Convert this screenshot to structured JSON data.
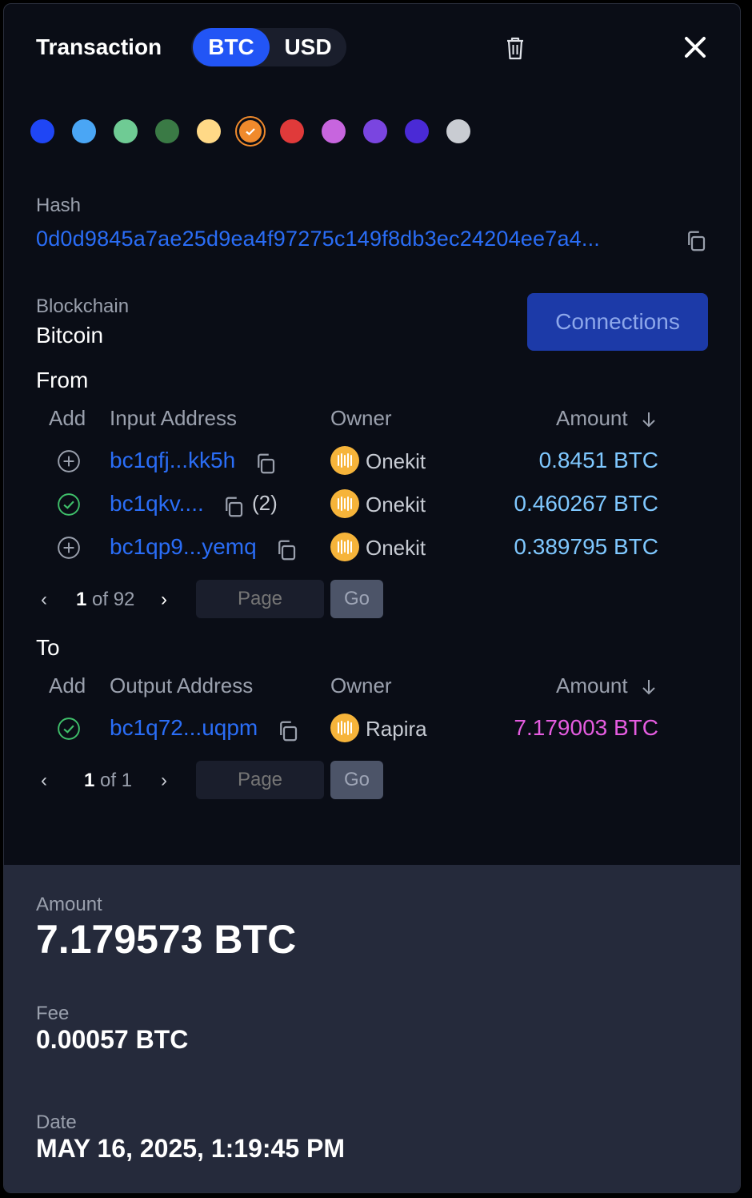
{
  "header": {
    "title": "Transaction",
    "currency_options": [
      "BTC",
      "USD"
    ],
    "selected_currency": "BTC"
  },
  "colors": [
    "#1f46f5",
    "#4aa6f5",
    "#6fcb94",
    "#3a7a45",
    "#ffd987",
    "#f08a2c",
    "#e03a3a",
    "#c765de",
    "#7a45e0",
    "#4a2ad6",
    "#c9ccd2"
  ],
  "selected_color_index": 5,
  "hash": {
    "label": "Hash",
    "value": "0d0d9845a7ae25d9ea4f97275c149f8db3ec24204ee7a4..."
  },
  "blockchain": {
    "label": "Blockchain",
    "value": "Bitcoin"
  },
  "connections_label": "Connections",
  "from": {
    "title": "From",
    "headers": {
      "add": "Add",
      "address": "Input Address",
      "owner": "Owner",
      "amount": "Amount"
    },
    "rows": [
      {
        "address": "bc1qfj...kk5h",
        "extra": "",
        "owner": "Onekit",
        "amount": "0.8451 BTC",
        "added": false
      },
      {
        "address": "bc1qkv....",
        "extra": "(2)",
        "owner": "Onekit",
        "amount": "0.460267 BTC",
        "added": true
      },
      {
        "address": "bc1qp9...yemq",
        "extra": "",
        "owner": "Onekit",
        "amount": "0.389795 BTC",
        "added": false
      }
    ],
    "pager": {
      "current": "1",
      "of_text": " of 92",
      "placeholder": "Page",
      "go": "Go"
    }
  },
  "to": {
    "title": "To",
    "headers": {
      "add": "Add",
      "address": "Output Address",
      "owner": "Owner",
      "amount": "Amount"
    },
    "rows": [
      {
        "address": "bc1q72...uqpm",
        "extra": "",
        "owner": "Rapira",
        "amount": "7.179003 BTC",
        "added": true
      }
    ],
    "pager": {
      "current": "1",
      "of_text": " of 1",
      "placeholder": "Page",
      "go": "Go"
    }
  },
  "summary": {
    "amount_label": "Amount",
    "amount_value": "7.179573 BTC",
    "fee_label": "Fee",
    "fee_value": "0.00057 BTC",
    "date_label": "Date",
    "date_value": "MAY 16, 2025, 1:19:45 PM"
  }
}
